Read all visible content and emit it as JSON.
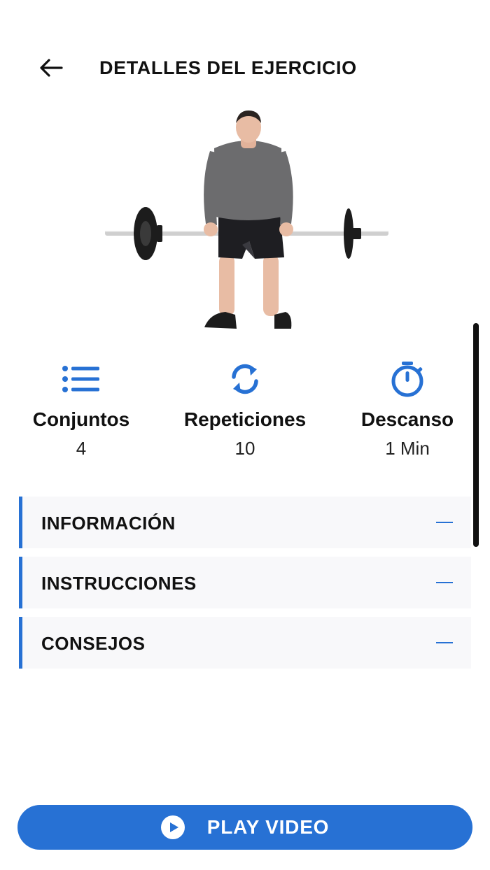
{
  "header": {
    "title": "DETALLES DEL EJERCICIO",
    "back_icon": "arrow-left-icon"
  },
  "hero": {
    "image": "barbell-deadlift-illustration"
  },
  "stats": [
    {
      "icon": "list-icon",
      "label": "Conjuntos",
      "value": "4"
    },
    {
      "icon": "repeat-icon",
      "label": "Repeticiones",
      "value": "10"
    },
    {
      "icon": "stopwatch-icon",
      "label": "Descanso",
      "value": "1 Min"
    }
  ],
  "sections": [
    {
      "label": "INFORMACIÓN",
      "toggle_icon": "minus-icon"
    },
    {
      "label": "INSTRUCCIONES",
      "toggle_icon": "minus-icon"
    },
    {
      "label": "CONSEJOS",
      "toggle_icon": "minus-icon"
    }
  ],
  "play_button": {
    "label": "PLAY VIDEO",
    "icon": "play-circle-icon"
  },
  "colors": {
    "accent": "#2771d4",
    "section_bg": "#f8f8fa",
    "text": "#111111"
  }
}
